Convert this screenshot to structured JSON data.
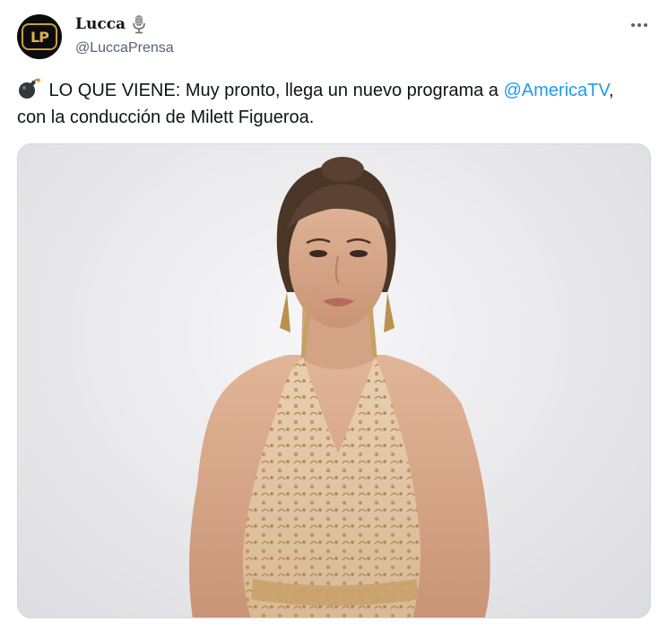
{
  "author": {
    "display_name": "Lucca",
    "handle": "@LuccaPrensa",
    "avatar_monogram": "LP",
    "badge_icon": "microphone-icon"
  },
  "tweet": {
    "emoji_icon": "bomb-icon",
    "text_part1": " LO QUE VIENE: Muy pronto, llega un nuevo programa a ",
    "mention": "@AmericaTV",
    "text_part2": ",",
    "text_line2": "con la conducción de Milett  Figueroa."
  },
  "media": {
    "alt": "photo-woman-in-gold-beaded-halter-dress"
  },
  "colors": {
    "accent": "#1d9bf0",
    "text": "#0f1419",
    "secondary": "#536471",
    "avatar_gold": "#d9b24a"
  }
}
